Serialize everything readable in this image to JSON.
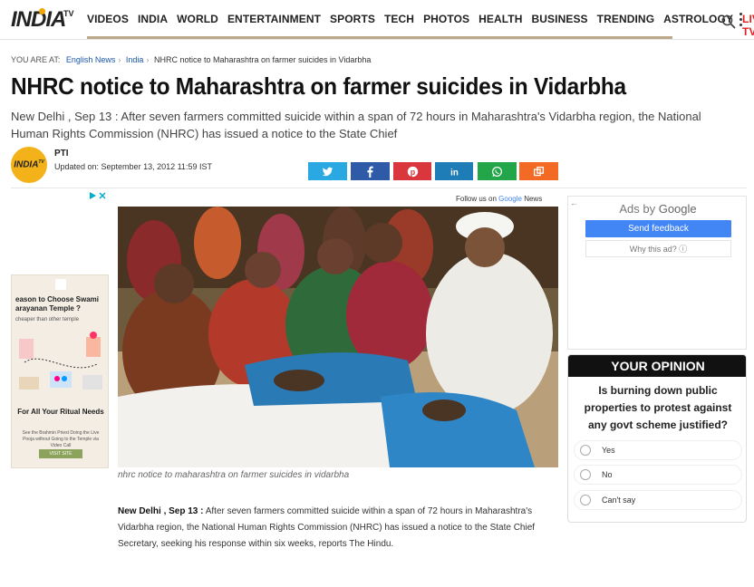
{
  "header": {
    "logo_text": "INDIA",
    "logo_tv": "TV",
    "nav": [
      "VIDEOS",
      "INDIA",
      "WORLD",
      "ENTERTAINMENT",
      "SPORTS",
      "TECH",
      "PHOTOS",
      "HEALTH",
      "BUSINESS",
      "TRENDING",
      "ASTROLOGY",
      "LIVE TV"
    ]
  },
  "breadcrumb": {
    "label": "YOU ARE AT:",
    "items": [
      "English News",
      "India"
    ],
    "current": "NHRC notice to Maharashtra on farmer suicides in Vidarbha"
  },
  "article": {
    "title": "NHRC notice to Maharashtra on farmer suicides in Vidarbha",
    "summary": "New Delhi , Sep 13 : After seven farmers committed suicide within a span of  72 hours in  Maharashtra's Vidarbha region, the National Human Rights Commission (NHRC) has issued a notice to the State Chief",
    "author": "PTI",
    "updated": "Updated on: September 13, 2012 11:59 IST",
    "follow_prefix": "Follow us on",
    "follow_google": "Google",
    "follow_news": "News",
    "caption": "nhrc notice to maharashtra on farmer suicides in vidarbha",
    "body_dateline": "New Delhi , Sep 13 :",
    "body_text": " After seven farmers committed suicide within a span of  72 hours in Maharashtra's Vidarbha region, the National Human Rights Commission (NHRC) has issued a notice to the State Chief Secretary, seeking his response within six weeks, reports The Hindu."
  },
  "share_buttons": [
    {
      "name": "twitter",
      "color": "#29a8e1"
    },
    {
      "name": "facebook",
      "color": "#2f5aa7"
    },
    {
      "name": "pinterest",
      "color": "#d9363e"
    },
    {
      "name": "linkedin",
      "color": "#1e7cb6"
    },
    {
      "name": "whatsapp",
      "color": "#23a54a"
    },
    {
      "name": "copy",
      "color": "#f26a24"
    }
  ],
  "left_ad": {
    "headline": "eason to Choose Swami arayanan Temple ?",
    "sub": "cheaper than other temple",
    "cta_head": "For All Your Ritual Needs",
    "cta_sub": "See the Brahmin Priest Doing the Live Pooja without Going to the Temple via Video Call",
    "cta_btn": "VISIT SITE"
  },
  "right_ad": {
    "ads_by": "Ads by",
    "google": "Google",
    "feedback": "Send feedback",
    "why": "Why this ad? ⓘ"
  },
  "poll": {
    "header": "YOUR OPINION",
    "question": "Is burning down public properties to protest against any govt scheme justified?",
    "options": [
      "Yes",
      "No",
      "Can't say"
    ]
  }
}
